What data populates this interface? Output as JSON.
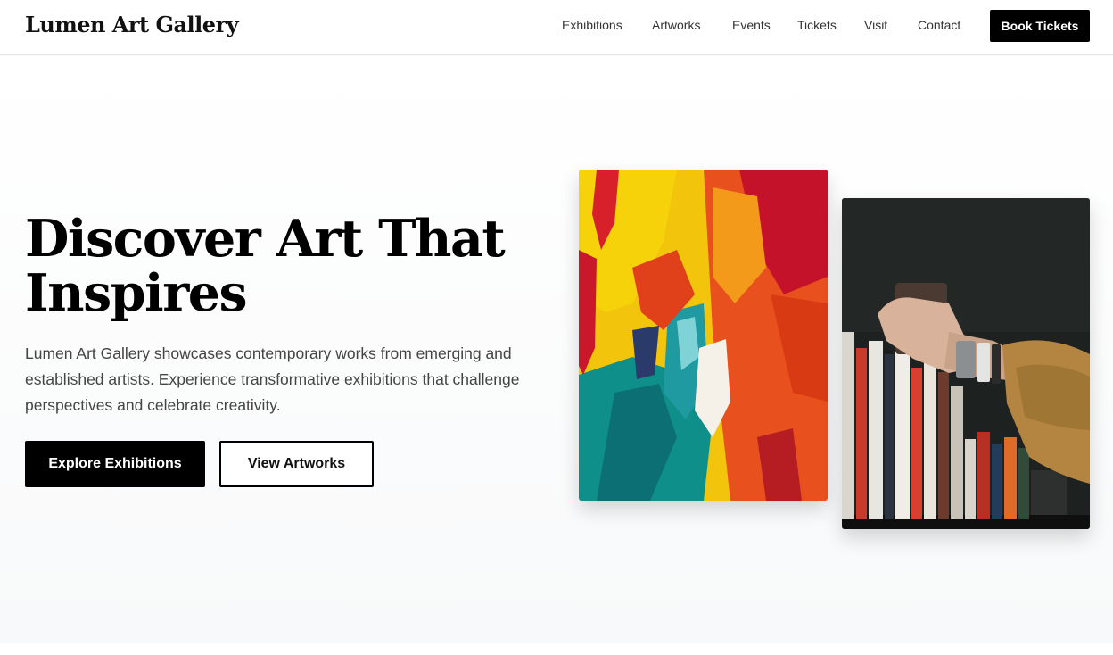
{
  "header": {
    "brand": "Lumen Art Gallery",
    "nav": [
      "Exhibitions",
      "Artworks",
      "Events",
      "Tickets",
      "Visit",
      "Contact"
    ],
    "cta": "Book Tickets"
  },
  "hero": {
    "title_line1": "Discover Art That",
    "title_line2": "Inspires",
    "description": "Lumen Art Gallery showcases contemporary works from emerging and established artists. Experience transformative exhibitions that challenge perspectives and celebrate creativity.",
    "primary_button": "Explore Exhibitions",
    "secondary_button": "View Artworks"
  },
  "images": {
    "painting": "abstract-painting-image",
    "books": "bookshelf-hand-image"
  },
  "colors": {
    "primary": "#000000",
    "background": "#ffffff",
    "hero_bg_bottom": "#f8f9fa",
    "text_muted": "#444444"
  }
}
